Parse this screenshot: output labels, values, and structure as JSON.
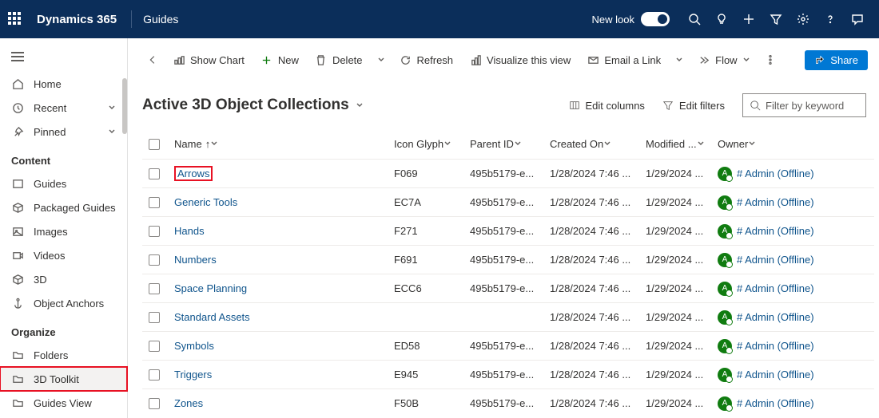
{
  "topbar": {
    "brand": "Dynamics 365",
    "app": "Guides",
    "newlook": "New look"
  },
  "sidebar": {
    "home": "Home",
    "recent": "Recent",
    "pinned": "Pinned",
    "content_hdr": "Content",
    "guides": "Guides",
    "packaged": "Packaged Guides",
    "images": "Images",
    "videos": "Videos",
    "three_d": "3D",
    "anchors": "Object Anchors",
    "organize_hdr": "Organize",
    "folders": "Folders",
    "toolkit": "3D Toolkit",
    "guides_view": "Guides View"
  },
  "cmdbar": {
    "show_chart": "Show Chart",
    "new": "New",
    "delete": "Delete",
    "refresh": "Refresh",
    "visualize": "Visualize this view",
    "email": "Email a Link",
    "flow": "Flow",
    "share": "Share"
  },
  "view": {
    "title": "Active 3D Object Collections",
    "edit_cols": "Edit columns",
    "edit_filters": "Edit filters",
    "filter_ph": "Filter by keyword"
  },
  "columns": {
    "name": "Name",
    "icon": "Icon Glyph",
    "parent": "Parent ID",
    "created": "Created On",
    "modified": "Modified ...",
    "owner": "Owner"
  },
  "rows": [
    {
      "name": "Arrows",
      "icon": "F069",
      "parent": "495b5179-e...",
      "created": "1/28/2024 7:46 ...",
      "modified": "1/29/2024 ...",
      "owner": "# Admin (Offline)",
      "hl": true
    },
    {
      "name": "Generic Tools",
      "icon": "EC7A",
      "parent": "495b5179-e...",
      "created": "1/28/2024 7:46 ...",
      "modified": "1/29/2024 ...",
      "owner": "# Admin (Offline)"
    },
    {
      "name": "Hands",
      "icon": "F271",
      "parent": "495b5179-e...",
      "created": "1/28/2024 7:46 ...",
      "modified": "1/29/2024 ...",
      "owner": "# Admin (Offline)"
    },
    {
      "name": "Numbers",
      "icon": "F691",
      "parent": "495b5179-e...",
      "created": "1/28/2024 7:46 ...",
      "modified": "1/29/2024 ...",
      "owner": "# Admin (Offline)"
    },
    {
      "name": "Space Planning",
      "icon": "ECC6",
      "parent": "495b5179-e...",
      "created": "1/28/2024 7:46 ...",
      "modified": "1/29/2024 ...",
      "owner": "# Admin (Offline)"
    },
    {
      "name": "Standard Assets",
      "icon": "",
      "parent": "",
      "created": "1/28/2024 7:46 ...",
      "modified": "1/29/2024 ...",
      "owner": "# Admin (Offline)"
    },
    {
      "name": "Symbols",
      "icon": "ED58",
      "parent": "495b5179-e...",
      "created": "1/28/2024 7:46 ...",
      "modified": "1/29/2024 ...",
      "owner": "# Admin (Offline)"
    },
    {
      "name": "Triggers",
      "icon": "E945",
      "parent": "495b5179-e...",
      "created": "1/28/2024 7:46 ...",
      "modified": "1/29/2024 ...",
      "owner": "# Admin (Offline)"
    },
    {
      "name": "Zones",
      "icon": "F50B",
      "parent": "495b5179-e...",
      "created": "1/28/2024 7:46 ...",
      "modified": "1/29/2024 ...",
      "owner": "# Admin (Offline)"
    }
  ]
}
